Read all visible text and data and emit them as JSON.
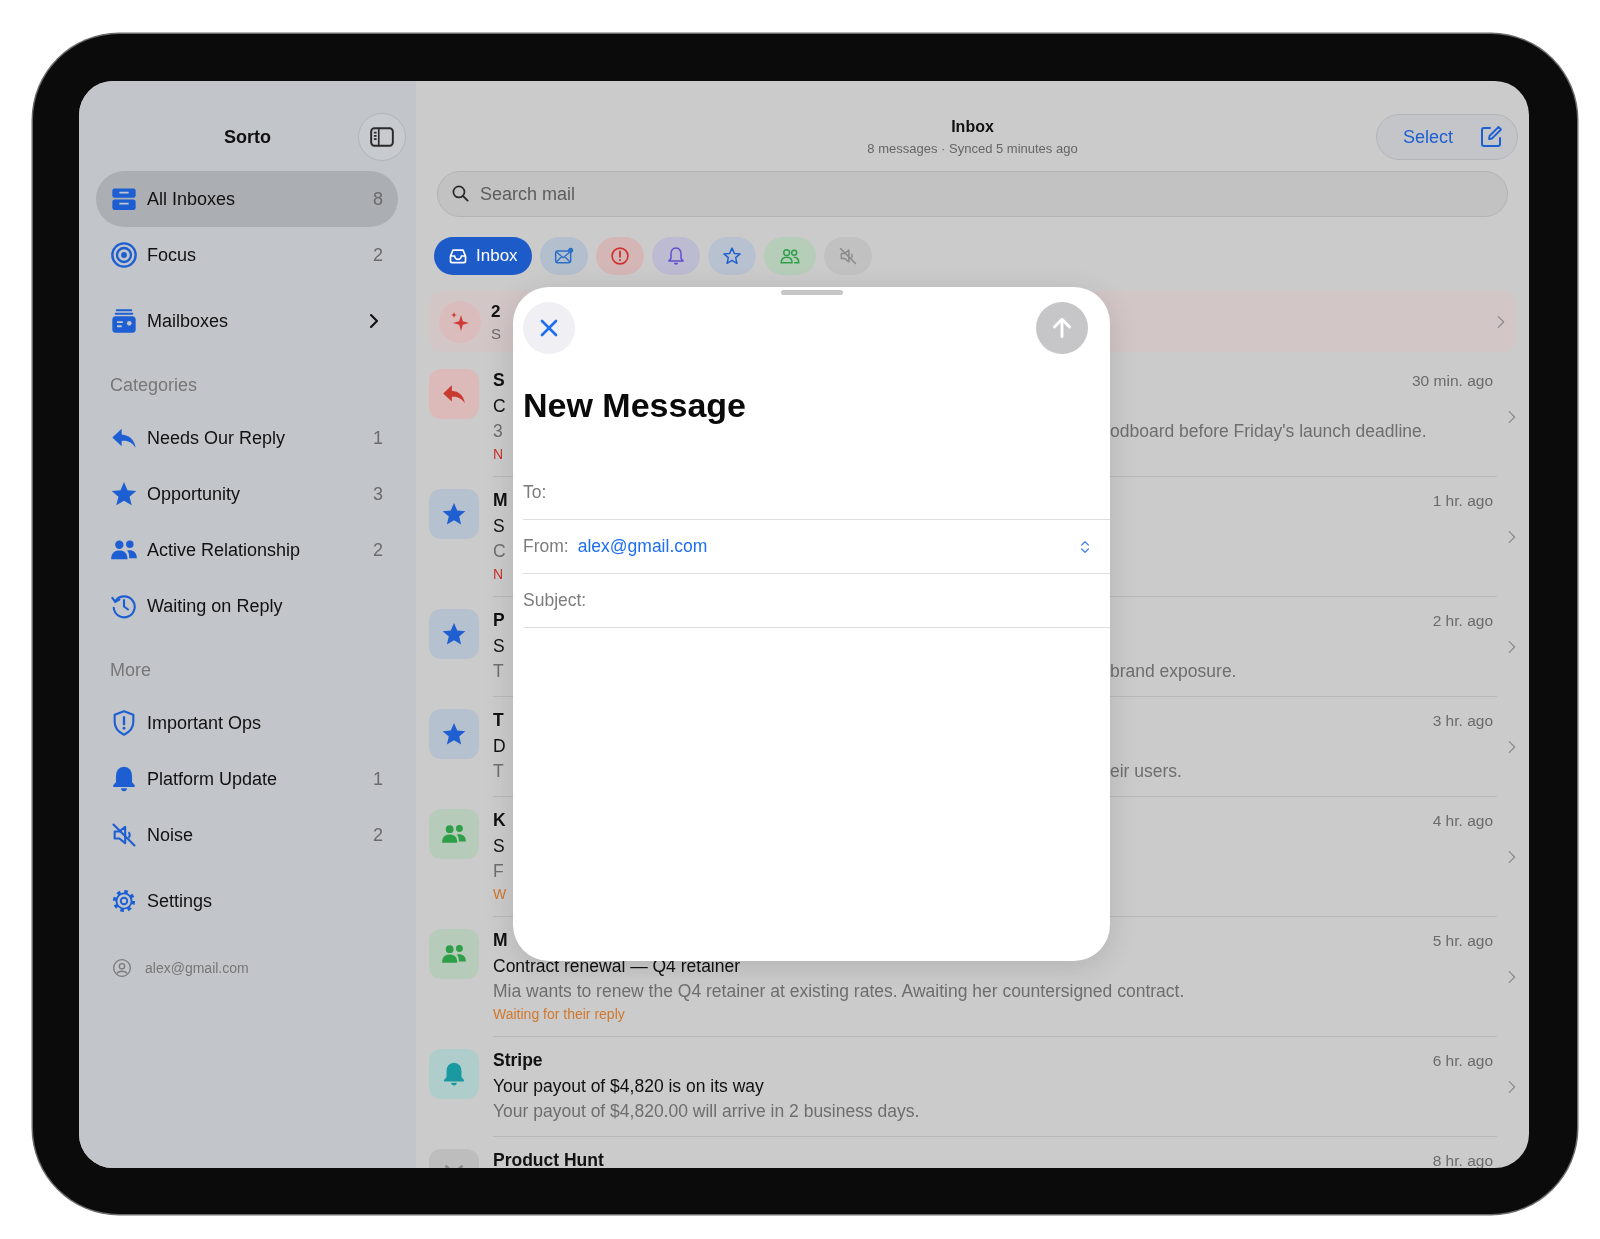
{
  "sidebar": {
    "title": "Sorto",
    "items": [
      {
        "label": "All Inboxes",
        "count": "8",
        "selected": true
      },
      {
        "label": "Focus",
        "count": "2",
        "selected": false
      }
    ],
    "mailboxes": {
      "label": "Mailboxes",
      "expanded": false
    },
    "sections": [
      {
        "heading": "Categories",
        "items": [
          {
            "label": "Needs Our Reply",
            "count": "1",
            "selected": false
          },
          {
            "label": "Opportunity",
            "count": "3",
            "selected": false
          },
          {
            "label": "Active Relationship",
            "count": "2",
            "selected": false
          },
          {
            "label": "Waiting on Reply",
            "selected": false
          }
        ]
      },
      {
        "heading": "More",
        "items": [
          {
            "label": "Important Ops",
            "selected": false
          },
          {
            "label": "Platform Update",
            "count": "1",
            "selected": false
          },
          {
            "label": "Noise",
            "count": "2",
            "selected": false
          }
        ]
      }
    ],
    "settings": "Settings",
    "account": "alex@gmail.com"
  },
  "header": {
    "title": "Inbox",
    "subtitle": "8 messages · Synced 5 minutes ago",
    "select": "Select"
  },
  "search": {
    "placeholder": "Search mail"
  },
  "filters": [
    {
      "kind": "inbox",
      "label": "Inbox",
      "selected": true
    },
    {
      "kind": "unread",
      "selected": false
    },
    {
      "kind": "important",
      "selected": false
    },
    {
      "kind": "update",
      "selected": false
    },
    {
      "kind": "opportunity",
      "selected": false
    },
    {
      "kind": "relationship",
      "selected": false
    },
    {
      "kind": "noise",
      "selected": false
    }
  ],
  "summary": {
    "title": "2",
    "subtitle": "S"
  },
  "messages": [
    {
      "kind": "reply",
      "sender": "S",
      "subject": "C",
      "preview": "3",
      "preview_end": "odboard before Friday's launch deadline.",
      "time": "30 min. ago",
      "tag": {
        "text": "N",
        "color": "#c8322b"
      }
    },
    {
      "kind": "star",
      "sender": "M",
      "subject": "S",
      "preview": "C",
      "time": "1 hr. ago",
      "tag": {
        "text": "N",
        "color": "#c8322b"
      }
    },
    {
      "kind": "star",
      "sender": "P",
      "subject": "S",
      "preview": "T",
      "preview_end": "brand exposure.",
      "time": "2 hr. ago"
    },
    {
      "kind": "star",
      "sender": "T",
      "subject": "D",
      "preview": "T",
      "preview_end": "eir users.",
      "time": "3 hr. ago"
    },
    {
      "kind": "people",
      "sender": "K",
      "subject": "S",
      "preview": "F",
      "time": "4 hr. ago",
      "tag": {
        "text": "W",
        "color": "#d0782c"
      }
    },
    {
      "kind": "people",
      "sender": "M",
      "subject": "Contract renewal — Q4 retainer",
      "preview": "Mia wants to renew the Q4 retainer at existing rates. Awaiting her countersigned contract.",
      "time": "5 hr. ago",
      "tag": {
        "text": "Waiting for their reply",
        "color": "#d0782c"
      }
    },
    {
      "kind": "bell",
      "sender": "Stripe",
      "subject": "Your payout of $4,820 is on its way",
      "preview": "Your payout of $4,820.00 will arrive in 2 business days.",
      "time": "6 hr. ago"
    },
    {
      "kind": "muted",
      "sender": "Product Hunt",
      "time": "8 hr. ago"
    }
  ],
  "compose": {
    "title": "New Message",
    "fields": [
      {
        "kind": "text",
        "label": "To:"
      },
      {
        "kind": "picker",
        "label": "From:",
        "value": "alex@gmail.com"
      },
      {
        "kind": "text",
        "label": "Subject:"
      }
    ]
  }
}
